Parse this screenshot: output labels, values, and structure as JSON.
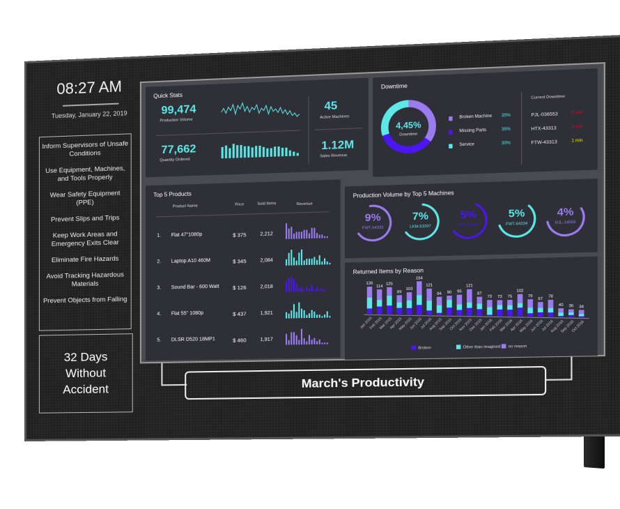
{
  "sidebar": {
    "time": "08:27 AM",
    "date": "Tuesday, January 22, 2019",
    "safety_rules": [
      "Inform Supervisors of Unsafe Conditions",
      "Use Equipment, Machines, and Tools Properly",
      "Wear Safety Equipment (PPE)",
      "Prevent Slips and Trips",
      "Keep Work Areas and Emergency Exits Clear",
      "Eliminate Fire Hazards",
      "Avoid Tracking Hazardous Materials",
      "Prevent Objects from Falling"
    ],
    "days_line1": "32 Days",
    "days_line2": "Without",
    "days_line3": "Accident"
  },
  "footer_title": "March's Productivity",
  "colors": {
    "cyan": "#5de8e8",
    "purple": "#9b7cf0",
    "violet": "#4b16f0",
    "red": "#d0102a",
    "yellow": "#e6e600",
    "card": "#2e2f37"
  },
  "quick_stats": {
    "title": "Quick Stats",
    "production_volume": "99,474",
    "production_volume_label": "Production Volume",
    "quantity_ordered": "77,662",
    "quantity_ordered_label": "Quantity Ordered",
    "active_machines": "45",
    "active_machines_label": "Active Machines",
    "sales_revenue": "1.12M",
    "sales_revenue_label": "Sales Revenue",
    "sparkline": [
      6,
      9,
      5,
      10,
      7,
      12,
      4,
      11,
      8,
      13,
      6,
      10,
      5,
      9,
      7,
      11,
      4,
      8,
      6,
      10,
      3,
      9,
      5,
      7,
      4,
      8,
      3,
      6,
      2,
      5,
      1,
      3,
      0,
      2
    ],
    "bars": [
      8,
      9,
      7,
      10,
      9,
      9,
      8,
      8,
      7,
      8,
      8,
      7,
      6,
      6,
      7,
      7,
      6,
      6,
      4,
      3,
      2
    ]
  },
  "downtime": {
    "title": "Downtime",
    "center_value": "4,45%",
    "center_label": "Downtime",
    "legend": [
      {
        "label": "Broken Machine",
        "value": "35%",
        "pct": 35,
        "color": "#9b7cf0"
      },
      {
        "label": "Missing Parts",
        "value": "35%",
        "pct": 35,
        "color": "#4b16f0"
      },
      {
        "label": "Service",
        "value": "30%",
        "pct": 30,
        "color": "#5de8e8"
      }
    ],
    "current_title": "Current Downtime",
    "current": [
      {
        "id": "PJL-036553",
        "time": "5 min",
        "color": "#d0102a"
      },
      {
        "id": "HTX-43313",
        "time": "3 min",
        "color": "#d0102a"
      },
      {
        "id": "FTW-43313",
        "time": "1 min",
        "color": "#e6e600"
      }
    ]
  },
  "top_products": {
    "title": "Top 5 Products",
    "headers": [
      "Product Name",
      "Price",
      "Sold Items",
      "Revenue"
    ],
    "rows": [
      {
        "rank": "1.",
        "name": "Flat 47\"1080p",
        "price": "$ 375",
        "sold": "2,212",
        "color": "#9b7cf0",
        "spark": [
          9,
          6,
          7,
          3,
          4,
          4,
          4,
          5,
          5,
          3,
          6,
          6,
          3,
          2,
          2,
          1,
          1
        ]
      },
      {
        "rank": "2.",
        "name": "Laptop A10 460M",
        "price": "$ 345",
        "sold": "2,084",
        "color": "#5de8e8",
        "spark": [
          4,
          8,
          10,
          5,
          3,
          8,
          10,
          3,
          4,
          4,
          4,
          5,
          3,
          6,
          2,
          4,
          2,
          1
        ]
      },
      {
        "rank": "3.",
        "name": "Sound Bar - 600 Watt",
        "price": "$ 126",
        "sold": "2,018",
        "color": "#4b16f0",
        "spark": [
          7,
          9,
          10,
          8,
          5,
          2,
          3,
          1,
          3,
          2,
          4,
          1,
          3,
          1,
          2,
          1
        ]
      },
      {
        "rank": "4.",
        "name": "Flat 55\" 1080p",
        "price": "$ 437",
        "sold": "1,921",
        "color": "#5de8e8",
        "spark": [
          4,
          3,
          5,
          9,
          4,
          10,
          6,
          5,
          2,
          3,
          5,
          4,
          2,
          2,
          1,
          2,
          4,
          1
        ]
      },
      {
        "rank": "5.",
        "name": "DLSR D520 18MP1",
        "price": "$ 460",
        "sold": "1,917",
        "color": "#9b7cf0",
        "spark": [
          7,
          3,
          8,
          8,
          6,
          3,
          10,
          4,
          2,
          6,
          3,
          4,
          2,
          3,
          1,
          1,
          1
        ]
      }
    ]
  },
  "machines": {
    "title": "Production Volume by Top 5 Machines",
    "items": [
      {
        "value": "9%",
        "pct": 9,
        "id": "FWT-64333",
        "color": "#9b7cf0"
      },
      {
        "value": "7%",
        "pct": 7,
        "id": "LKM-53397",
        "color": "#5de8e8"
      },
      {
        "value": "5%",
        "pct": 5,
        "id": "FWT-64333",
        "color": "#4b16f0"
      },
      {
        "value": "5%",
        "pct": 5,
        "id": "FWT-64334",
        "color": "#5de8e8"
      },
      {
        "value": "4%",
        "pct": 4,
        "id": "RJL-14564",
        "color": "#9b7cf0"
      }
    ]
  },
  "chart_data": {
    "type": "bar",
    "title": "Returned Items by Reason",
    "stacked": true,
    "categories": [
      "Jan 2015",
      "Feb 2015",
      "Mar 2015",
      "Apr 2015",
      "May 2015",
      "Jun 2015",
      "Jul 2015",
      "Aug 2015",
      "Sep 2015",
      "Oct 2015",
      "Nov 2015",
      "Dec 2015",
      "Jan 2016",
      "Feb 2016",
      "Mar 2016",
      "Apr 2016",
      "May 2016",
      "Jun 2016",
      "Jul 2016",
      "Aug 2016",
      "Sep 2016",
      "Oct 2016"
    ],
    "totals": [
      126,
      114,
      125,
      89,
      103,
      154,
      121,
      84,
      90,
      95,
      121,
      87,
      73,
      73,
      75,
      102,
      79,
      67,
      78,
      40,
      36,
      34
    ],
    "series": [
      {
        "name": "Broken",
        "color": "#4b16f0",
        "values": [
          25,
          35,
          40,
          30,
          30,
          45,
          20,
          10,
          35,
          25,
          35,
          30,
          5,
          30,
          30,
          40,
          15,
          20,
          20,
          5,
          10,
          5
        ]
      },
      {
        "name": "Other than imagined",
        "color": "#5de8e8",
        "values": [
          50,
          30,
          45,
          25,
          35,
          45,
          45,
          35,
          35,
          25,
          25,
          25,
          35,
          20,
          20,
          20,
          25,
          20,
          20,
          15,
          12,
          10
        ]
      },
      {
        "name": "no reason",
        "color": "#9b7cf0",
        "values": [
          51,
          49,
          40,
          34,
          38,
          64,
          56,
          39,
          20,
          45,
          61,
          32,
          33,
          23,
          25,
          42,
          39,
          27,
          38,
          20,
          14,
          19
        ]
      }
    ],
    "legend": "bottom",
    "xlabel": "",
    "ylabel": ""
  }
}
